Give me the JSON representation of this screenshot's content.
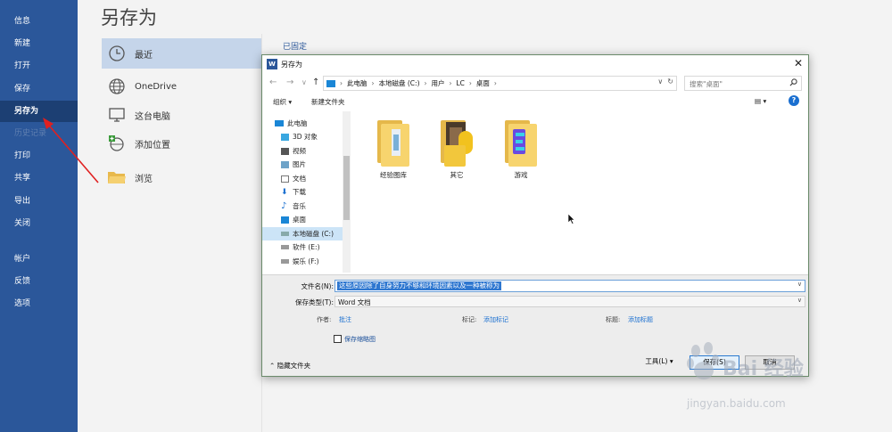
{
  "sidebar": {
    "items": [
      {
        "label": "信息"
      },
      {
        "label": "新建"
      },
      {
        "label": "打开"
      },
      {
        "label": "保存"
      },
      {
        "label": "另存为"
      },
      {
        "label": "历史记录"
      },
      {
        "label": "打印"
      },
      {
        "label": "共享"
      },
      {
        "label": "导出"
      },
      {
        "label": "关闭"
      },
      {
        "label": "帐户"
      },
      {
        "label": "反馈"
      },
      {
        "label": "选项"
      }
    ],
    "active": "另存为",
    "colors": {
      "background": "#2b579a",
      "active": "#1c3f73"
    }
  },
  "backstage": {
    "title": "另存为",
    "locations": [
      {
        "label": "最近",
        "icon": "clock-icon",
        "selected": true
      },
      {
        "label": "OneDrive",
        "icon": "globe-icon"
      },
      {
        "label": "这台电脑",
        "icon": "computer-icon"
      },
      {
        "label": "添加位置",
        "icon": "add-location-icon"
      },
      {
        "label": "浏览",
        "icon": "folder-icon"
      }
    ],
    "pinned_label": "已固定"
  },
  "dialog": {
    "title": "另存为",
    "close_glyph": "✕",
    "nav": {
      "back": "←",
      "forward": "→",
      "dropdown": "∨",
      "up": "↑",
      "refresh": "↻"
    },
    "breadcrumb": [
      "此电脑",
      "本地磁盘 (C:)",
      "用户",
      "LC",
      "桌面"
    ],
    "search_placeholder": "搜索\"桌面\"",
    "toolbar": {
      "organize": "组织 ▾",
      "new_folder": "新建文件夹",
      "view_glyph": "▤ ▾",
      "help": "?"
    },
    "tree": [
      {
        "label": "此电脑",
        "icon": "computer-icon"
      },
      {
        "label": "3D 对象",
        "icon": "3d-objects-icon"
      },
      {
        "label": "视频",
        "icon": "video-icon"
      },
      {
        "label": "图片",
        "icon": "pictures-icon"
      },
      {
        "label": "文档",
        "icon": "documents-icon"
      },
      {
        "label": "下载",
        "icon": "download-icon"
      },
      {
        "label": "音乐",
        "icon": "music-icon"
      },
      {
        "label": "桌面",
        "icon": "desktop-icon"
      },
      {
        "label": "本地磁盘 (C:)",
        "icon": "drive-icon",
        "selected": true
      },
      {
        "label": "软件 (E:)",
        "icon": "drive-icon"
      },
      {
        "label": "娱乐 (F:)",
        "icon": "drive-icon"
      }
    ],
    "files": [
      {
        "name": "经验图库"
      },
      {
        "name": "其它"
      },
      {
        "name": "游戏"
      }
    ],
    "filename_label": "文件名(N):",
    "filename_value": "这些原因除了自身努力不够和环境因素以及一种被称为",
    "filetype_label": "保存类型(T):",
    "filetype_value": "Word 文档",
    "meta": {
      "author_label": "作者:",
      "author_value": "批注",
      "tags_label": "标记:",
      "tags_value": "添加标记",
      "title_label": "标题:",
      "title_value": "添加标题"
    },
    "thumbnail_label": "保存缩略图",
    "hide_folders": "隐藏文件夹",
    "tools": "工具(L)",
    "save": "保存(S)",
    "cancel": "取消"
  },
  "watermark": {
    "brand": "Bai 经验",
    "url": "jingyan.baidu.com"
  }
}
